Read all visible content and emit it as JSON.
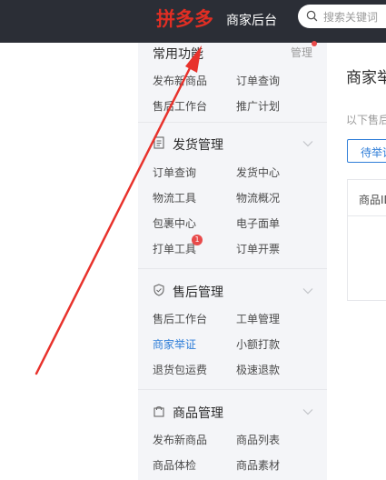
{
  "header": {
    "logo_text": "拼多多",
    "subtitle": "商家后台",
    "search_placeholder": "搜索关键词",
    "logo_color": "#e02e24",
    "bg_color": "#2b2e36"
  },
  "sidebar": {
    "common": {
      "title": "常用功能",
      "action": "管理",
      "items": [
        "发布新商品",
        "订单查询",
        "售后工作台",
        "推广计划"
      ]
    },
    "shipping": {
      "title": "发货管理",
      "icon": "document-icon",
      "items": [
        "订单查询",
        "发货中心",
        "物流工具",
        "物流概况",
        "包裹中心",
        "电子面单",
        "打单工具",
        "订单开票"
      ],
      "badge": "1"
    },
    "aftersale": {
      "title": "售后管理",
      "icon": "shield-icon",
      "items": [
        "售后工作台",
        "工单管理",
        "商家举证",
        "小额打款",
        "退货包运费",
        "极速退款"
      ],
      "active_item": "商家举证"
    },
    "goods": {
      "title": "商品管理",
      "icon": "bag-icon",
      "items": [
        "发布新商品",
        "商品列表",
        "商品体检",
        "商品素材"
      ]
    }
  },
  "main": {
    "title": "商家举",
    "desc": "以下售后",
    "pending_button": "待举证",
    "table_header": "商品ID"
  },
  "accent_color": "#2f7ed8",
  "annotation_color": "#e8322c"
}
